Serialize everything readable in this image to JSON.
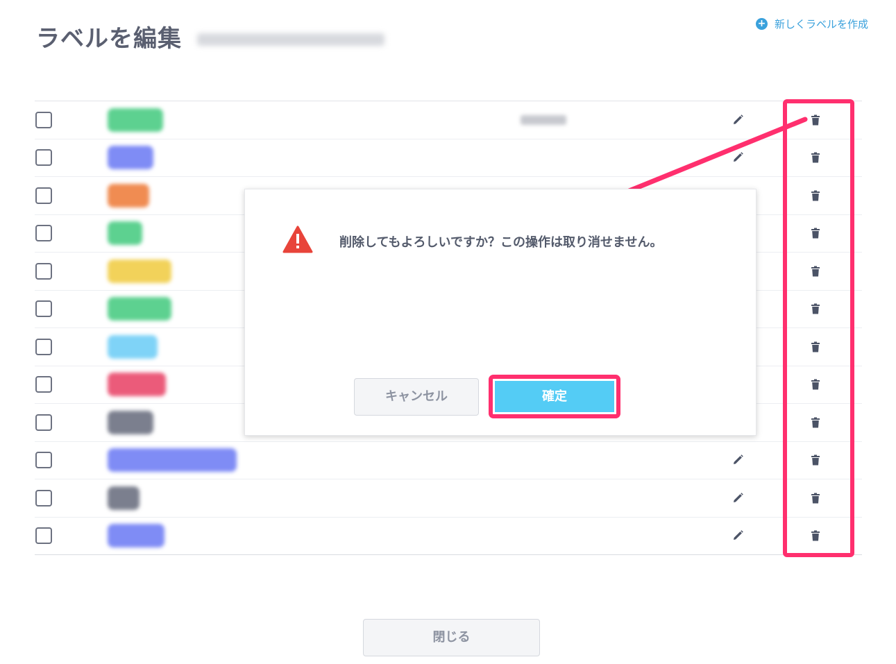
{
  "header": {
    "title": "ラベルを編集",
    "create_label": "新しくラベルを作成",
    "create_icon": "plus-circle-icon"
  },
  "rows": [
    {
      "color": "#5dd190",
      "has_desc": true,
      "edit_visible": true
    },
    {
      "color": "#7f8cf5",
      "has_desc": false,
      "edit_visible": true
    },
    {
      "color": "#f08c52",
      "has_desc": false,
      "edit_visible": false
    },
    {
      "color": "#5dd190",
      "has_desc": false,
      "edit_visible": false
    },
    {
      "color": "#f2d25a",
      "has_desc": false,
      "edit_visible": false
    },
    {
      "color": "#5dd190",
      "has_desc": false,
      "edit_visible": false
    },
    {
      "color": "#7fd3f7",
      "has_desc": false,
      "edit_visible": false
    },
    {
      "color": "#eb5b7a",
      "has_desc": false,
      "edit_visible": false
    },
    {
      "color": "#7b7f8e",
      "has_desc": false,
      "edit_visible": false
    },
    {
      "color": "#7f8cf5",
      "has_desc": false,
      "edit_visible": true
    },
    {
      "color": "#7b7f8e",
      "has_desc": false,
      "edit_visible": true
    },
    {
      "color": "#7f8cf5",
      "has_desc": false,
      "edit_visible": true
    }
  ],
  "dialog": {
    "message": "削除してもよろしいですか？この操作は取り消せません。",
    "cancel_label": "キャンセル",
    "confirm_label": "確定",
    "warning_color": "#e8443a"
  },
  "footer": {
    "close_label": "閉じる"
  },
  "colors": {
    "accent": "#3aa1dc",
    "highlight": "#ff2f6e",
    "confirm": "#54ccf5"
  }
}
